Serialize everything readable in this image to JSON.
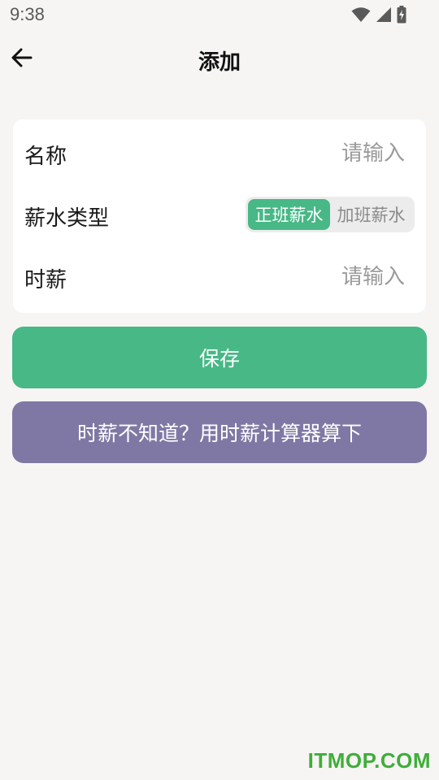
{
  "status_bar": {
    "time": "9:38",
    "icons": [
      "wifi-icon",
      "signal-icon",
      "battery-charging-icon"
    ]
  },
  "header": {
    "title": "添加",
    "back_icon": "arrow-left-icon"
  },
  "form": {
    "name_label": "名称",
    "name_placeholder": "请输入",
    "name_value": "",
    "salary_type_label": "薪水类型",
    "salary_type_options": [
      "正班薪水",
      "加班薪水"
    ],
    "salary_type_selected": "正班薪水",
    "hourly_label": "时薪",
    "hourly_placeholder": "请输入",
    "hourly_value": ""
  },
  "actions": {
    "save_label": "保存",
    "calculator_label": "时薪不知道？用时薪计算器算下"
  },
  "watermark": {
    "text": "ITMOP.COM"
  },
  "colors": {
    "background": "#f6f5f4",
    "card": "#ffffff",
    "accent_green": "#47b886",
    "accent_purple": "#8078a4",
    "watermark_green": "#3fae3a"
  }
}
